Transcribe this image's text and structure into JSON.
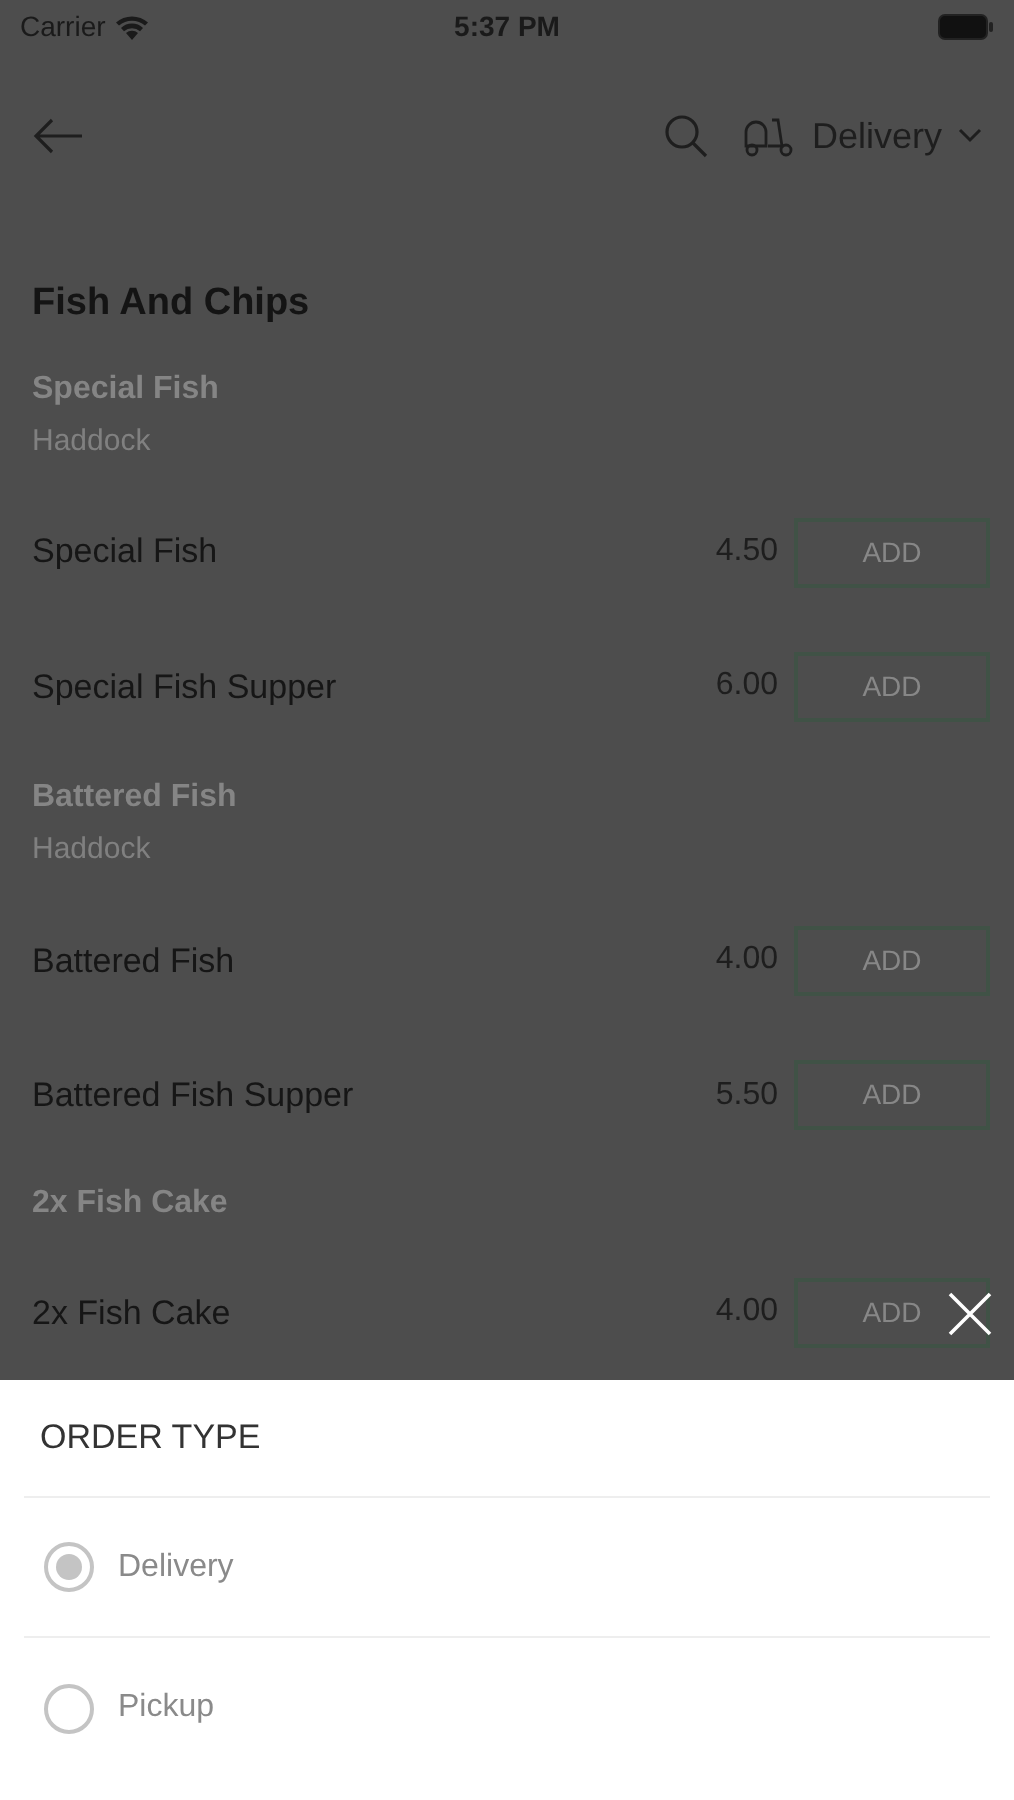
{
  "status_bar": {
    "carrier": "Carrier",
    "time": "5:37 PM"
  },
  "header": {
    "order_type": "Delivery"
  },
  "section": {
    "title": "Fish And Chips",
    "entries": [
      {
        "kind": "group",
        "title": "Special Fish",
        "subtitle": "Haddock"
      },
      {
        "kind": "item",
        "name": "Special Fish",
        "price": "4.50",
        "button": "ADD"
      },
      {
        "kind": "item",
        "name": "Special Fish Supper",
        "price": "6.00",
        "button": "ADD"
      },
      {
        "kind": "group",
        "title": "Battered Fish",
        "subtitle": "Haddock"
      },
      {
        "kind": "item",
        "name": "Battered Fish",
        "price": "4.00",
        "button": "ADD"
      },
      {
        "kind": "item",
        "name": "Battered Fish Supper",
        "price": "5.50",
        "button": "ADD"
      },
      {
        "kind": "group",
        "title": "2x Fish Cake"
      },
      {
        "kind": "item",
        "name": "2x Fish Cake",
        "price": "4.00",
        "button": "ADD"
      }
    ]
  },
  "sheet": {
    "title": "ORDER TYPE",
    "options": [
      {
        "label": "Delivery",
        "selected": true
      },
      {
        "label": "Pickup",
        "selected": false
      }
    ]
  }
}
